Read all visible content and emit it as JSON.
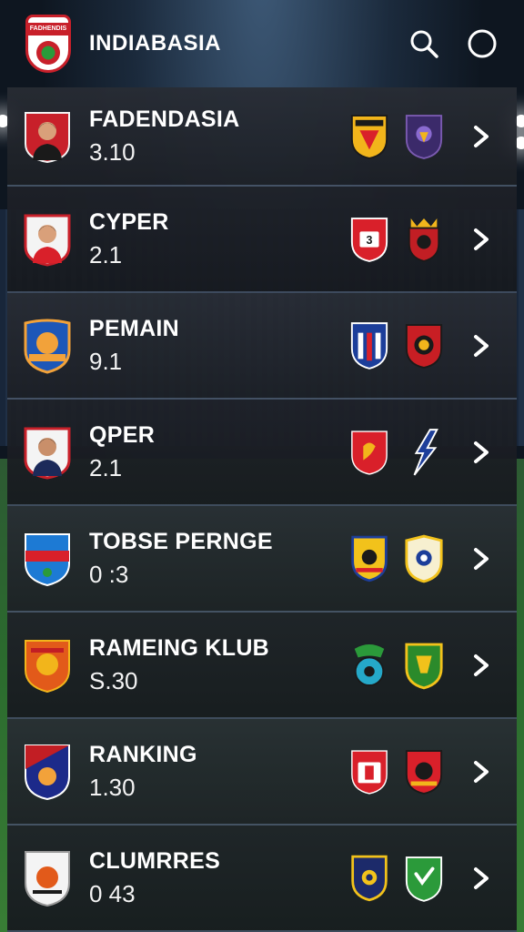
{
  "app": {
    "title": "INDIABASIA",
    "logo_label": "FADHENDIS"
  },
  "header": {
    "search_icon": "search-icon",
    "profile_icon": "circle-icon"
  },
  "rows": [
    {
      "title": "FADENDASIA",
      "score": "3.10",
      "avatar": "player-crest-red",
      "badge1_color": "#f2b51b",
      "badge2_color": "#3b2a6a"
    },
    {
      "title": "CYPER",
      "score": "2.1",
      "avatar": "player-crest-red",
      "badge1_color": "#d9202a",
      "badge2_color": "#c21e24"
    },
    {
      "title": "PEMAIN",
      "score": "9.1",
      "avatar": "team-crest-blue-orange",
      "badge1_color": "#1c3e9a",
      "badge2_color": "#c81e24"
    },
    {
      "title": "QPER",
      "score": "2.1",
      "avatar": "player-crest-red",
      "badge1_color": "#d9202a",
      "badge2_color": "#1e3e9a"
    },
    {
      "title": "TOBSE PERNGE",
      "score": "0 :3",
      "avatar": "team-crest-blue",
      "badge1_color": "#f2c21b",
      "badge2_color": "#f2c21b"
    },
    {
      "title": "RAMEING KLUB",
      "score": "S.30",
      "avatar": "team-crest-orange",
      "badge1_color": "#25a8c8",
      "badge2_color": "#2b8a2b"
    },
    {
      "title": "RANKING",
      "score": "1.30",
      "avatar": "team-crest-navy",
      "badge1_color": "#d9202a",
      "badge2_color": "#d9202a"
    },
    {
      "title": "CLUMRRES",
      "score": "0 43",
      "avatar": "team-crest-white",
      "badge1_color": "#f2c21b",
      "badge2_color": "#2b9a3a"
    }
  ]
}
